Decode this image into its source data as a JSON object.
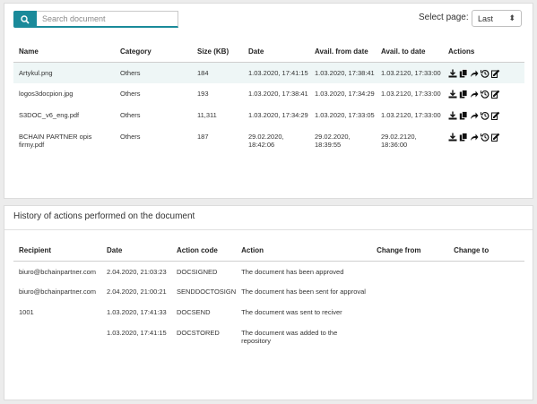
{
  "search": {
    "placeholder": "Search document",
    "value": ""
  },
  "page_select": {
    "label": "Select page:",
    "value": "Last"
  },
  "documents": {
    "columns": [
      "Name",
      "Category",
      "Size (KB)",
      "Date",
      "Avail. from date",
      "Avail. to date",
      "Actions"
    ],
    "rows": [
      {
        "name": "Artykul.png",
        "category": "Others",
        "size": "184",
        "date": "1.03.2020, 17:41:15",
        "from": "1.03.2020, 17:38:41",
        "to": "1.03.2120, 17:33:00"
      },
      {
        "name": "logos3docpion.jpg",
        "category": "Others",
        "size": "193",
        "date": "1.03.2020, 17:38:41",
        "from": "1.03.2020, 17:34:29",
        "to": "1.03.2120, 17:33:00"
      },
      {
        "name": "S3DOC_v6_eng.pdf",
        "category": "Others",
        "size": "11,311",
        "date": "1.03.2020, 17:34:29",
        "from": "1.03.2020, 17:33:05",
        "to": "1.03.2120, 17:33:00"
      },
      {
        "name": "BCHAIN PARTNER opis firmy.pdf",
        "category": "Others",
        "size": "187",
        "date": "29.02.2020, 18:42:06",
        "from": "29.02.2020, 18:39:55",
        "to": "29.02.2120, 18:36:00"
      }
    ],
    "action_icons": [
      "download-icon",
      "copy-icon",
      "share-icon",
      "history-icon",
      "edit-icon"
    ]
  },
  "history": {
    "title": "History of actions performed on the document",
    "columns": [
      "Recipient",
      "Date",
      "Action code",
      "Action",
      "Change from",
      "Change to"
    ],
    "rows": [
      {
        "recipient": "biuro@bchainpartner.com",
        "date": "2.04.2020, 21:03:23",
        "code": "DOCSIGNED",
        "action": "The document has been approved",
        "from": "",
        "to": ""
      },
      {
        "recipient": "biuro@bchainpartner.com",
        "date": "2.04.2020, 21:00:21",
        "code": "SENDDOCTOSIGN",
        "action": "The document has been sent for approval",
        "from": "",
        "to": ""
      },
      {
        "recipient": "1001",
        "date": "1.03.2020, 17:41:33",
        "code": "DOCSEND",
        "action": "The document was sent to reciver",
        "from": "",
        "to": ""
      },
      {
        "recipient": "",
        "date": "1.03.2020, 17:41:15",
        "code": "DOCSTORED",
        "action": "The document was added to the repository",
        "from": "",
        "to": ""
      }
    ]
  },
  "colors": {
    "accent": "#1a8a9a",
    "row_highlight": "#eef6f6"
  }
}
